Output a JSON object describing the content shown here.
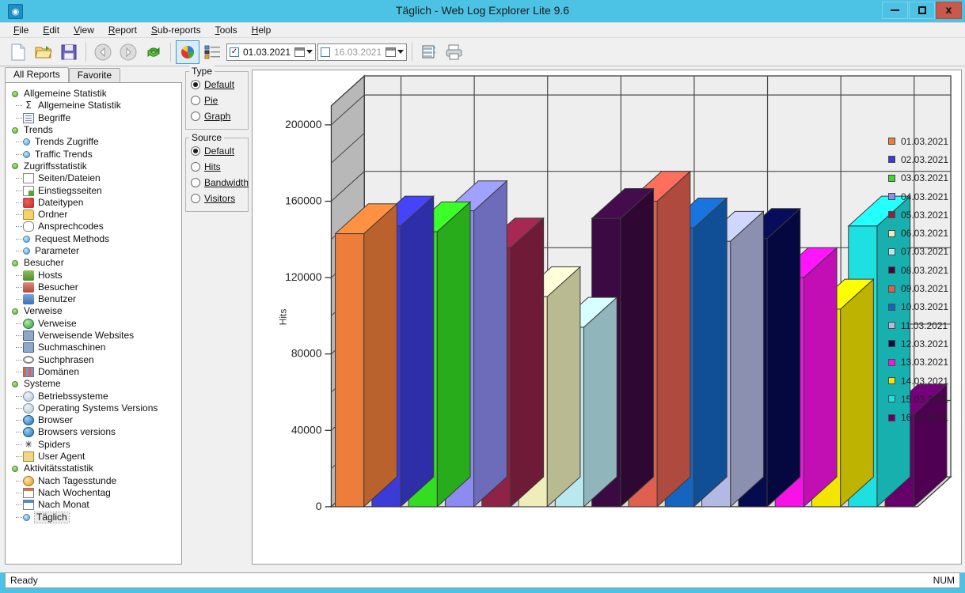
{
  "window": {
    "title": "Täglich - Web Log Explorer Lite 9.6",
    "app_icon": "app-icon",
    "minimize_label": "minimize-icon",
    "maximize_label": "maximize-icon",
    "close_label": "x"
  },
  "menubar": [
    {
      "label": "File",
      "accel": "F"
    },
    {
      "label": "Edit",
      "accel": "E"
    },
    {
      "label": "View",
      "accel": "V"
    },
    {
      "label": "Report",
      "accel": "R"
    },
    {
      "label": "Sub-reports",
      "accel": "S"
    },
    {
      "label": "Tools",
      "accel": "T"
    },
    {
      "label": "Help",
      "accel": "H"
    }
  ],
  "toolbar": {
    "buttons": [
      {
        "name": "new-document-icon"
      },
      {
        "name": "open-folder-icon"
      },
      {
        "name": "save-icon"
      },
      {
        "name": "back-arrow-icon"
      },
      {
        "name": "forward-arrow-icon"
      },
      {
        "name": "refresh-icon"
      },
      {
        "name": "chart-icon",
        "selected": true
      },
      {
        "name": "list-view-icon"
      },
      {
        "name": "table-report-icon"
      },
      {
        "name": "print-icon"
      }
    ],
    "date_from": {
      "value": "01.03.2021",
      "checked": true
    },
    "date_to": {
      "value": "16.03.2021",
      "checked": false
    }
  },
  "sidebar": {
    "tabs": [
      {
        "label": "All Reports",
        "active": true
      },
      {
        "label": "Favorite",
        "active": false
      }
    ],
    "tree": [
      {
        "label": "Allgemeine Statistik",
        "level": 0,
        "icon": "green-bullet-icon"
      },
      {
        "label": "Allgemeine Statistik",
        "level": 1,
        "icon": "sigma-icon"
      },
      {
        "label": "Begriffe",
        "level": 1,
        "icon": "grid-document-icon"
      },
      {
        "label": "Trends",
        "level": 0,
        "icon": "green-bullet-icon"
      },
      {
        "label": "Trends Zugriffe",
        "level": 1,
        "icon": "blue-dot-icon"
      },
      {
        "label": "Traffic Trends",
        "level": 1,
        "icon": "blue-dot-icon"
      },
      {
        "label": "Zugriffsstatistik",
        "level": 0,
        "icon": "green-bullet-icon"
      },
      {
        "label": "Seiten/Dateien",
        "level": 1,
        "icon": "page-icon"
      },
      {
        "label": "Einstiegsseiten",
        "level": 1,
        "icon": "page-arrow-icon"
      },
      {
        "label": "Dateitypen",
        "level": 1,
        "icon": "file-types-icon"
      },
      {
        "label": "Ordner",
        "level": 1,
        "icon": "folder-icon"
      },
      {
        "label": "Ansprechcodes",
        "level": 1,
        "icon": "speech-bubble-icon"
      },
      {
        "label": "Request Methods",
        "level": 1,
        "icon": "blue-dot-icon"
      },
      {
        "label": "Parameter",
        "level": 1,
        "icon": "blue-dot-icon"
      },
      {
        "label": "Besucher",
        "level": 0,
        "icon": "green-bullet-icon"
      },
      {
        "label": "Hosts",
        "level": 1,
        "icon": "user-green-icon"
      },
      {
        "label": "Besucher",
        "level": 1,
        "icon": "user-red-icon"
      },
      {
        "label": "Benutzer",
        "level": 1,
        "icon": "user-blue-icon"
      },
      {
        "label": "Verweise",
        "level": 0,
        "icon": "green-bullet-icon"
      },
      {
        "label": "Verweise",
        "level": 1,
        "icon": "globe-icon"
      },
      {
        "label": "Verweisende Websites",
        "level": 1,
        "icon": "monitor-icon"
      },
      {
        "label": "Suchmaschinen",
        "level": 1,
        "icon": "search-engine-icon"
      },
      {
        "label": "Suchphrasen",
        "level": 1,
        "icon": "magnifier-icon"
      },
      {
        "label": "Domänen",
        "level": 1,
        "icon": "domains-icon"
      },
      {
        "label": "Systeme",
        "level": 0,
        "icon": "green-bullet-icon"
      },
      {
        "label": "Betriebssysteme",
        "level": 1,
        "icon": "os-icon"
      },
      {
        "label": "Operating Systems Versions",
        "level": 1,
        "icon": "os-icon"
      },
      {
        "label": "Browser",
        "level": 1,
        "icon": "browser-icon"
      },
      {
        "label": "Browsers versions",
        "level": 1,
        "icon": "browser-icon"
      },
      {
        "label": "Spiders",
        "level": 1,
        "icon": "spider-icon"
      },
      {
        "label": "User Agent",
        "level": 1,
        "icon": "user-agent-icon"
      },
      {
        "label": "Aktivitätsstatistik",
        "level": 0,
        "icon": "green-bullet-icon"
      },
      {
        "label": "Nach Tagesstunde",
        "level": 1,
        "icon": "clock-icon"
      },
      {
        "label": "Nach Wochentag",
        "level": 1,
        "icon": "calendar-orange-icon"
      },
      {
        "label": "Nach Monat",
        "level": 1,
        "icon": "calendar-blue-icon"
      },
      {
        "label": "Täglich",
        "level": 1,
        "icon": "blue-dot-icon",
        "selected": true
      }
    ]
  },
  "options": {
    "type": {
      "legend": "Type",
      "items": [
        {
          "label": "Default",
          "accel": "D",
          "selected": true
        },
        {
          "label": "Pie",
          "accel": "P",
          "selected": false
        },
        {
          "label": "Graph",
          "accel": "G",
          "selected": false
        }
      ]
    },
    "source": {
      "legend": "Source",
      "items": [
        {
          "label": "Default",
          "accel": "a",
          "selected": true
        },
        {
          "label": "Hits",
          "accel": "H",
          "selected": false
        },
        {
          "label": "Bandwidth",
          "accel": "B",
          "selected": false
        },
        {
          "label": "Visitors",
          "accel": "V",
          "selected": false
        }
      ]
    }
  },
  "statusbar": {
    "message": "Ready",
    "num_indicator": "NUM"
  },
  "chart_data": {
    "type": "bar",
    "title": "Täglich",
    "xlabel": "",
    "ylabel": "Hits",
    "ylim": [
      0,
      210000
    ],
    "yticks": [
      0,
      40000,
      80000,
      120000,
      160000,
      200000
    ],
    "ytick_labels": [
      "0",
      "40000",
      "80000",
      "120000",
      "160000",
      "200000"
    ],
    "grid": true,
    "legend_position": "right",
    "three_d": true,
    "categories": [
      "01.03.2021",
      "02.03.2021",
      "03.03.2021",
      "04.03.2021",
      "05.03.2021",
      "06.03.2021",
      "07.03.2021",
      "08.03.2021",
      "09.03.2021",
      "10.03.2021",
      "11.03.2021",
      "12.03.2021",
      "13.03.2021",
      "14.03.2021",
      "15.03.2021",
      "16.03.2021"
    ],
    "values": [
      143000,
      147000,
      144000,
      155000,
      135500,
      110000,
      94000,
      151000,
      160000,
      146000,
      139000,
      140500,
      120000,
      103500,
      147000,
      48500
    ],
    "colors": [
      "#ed7d3a",
      "#3b3bd8",
      "#33dd22",
      "#8b8bf0",
      "#8e2347",
      "#efeebb",
      "#b9e8ef",
      "#3b0a42",
      "#e0604f",
      "#1565c0",
      "#b3b9e2",
      "#060a4f",
      "#f713e7",
      "#f2e500",
      "#1fe0e0",
      "#66006b"
    ]
  }
}
